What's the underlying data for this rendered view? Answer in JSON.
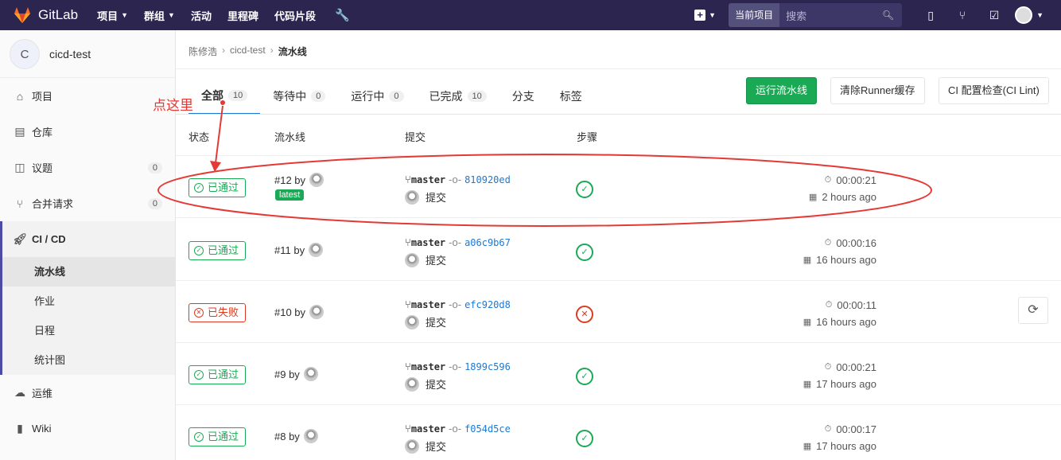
{
  "nav": {
    "brand": "GitLab",
    "links": [
      "项目",
      "群组",
      "活动",
      "里程碑",
      "代码片段"
    ],
    "search_scope": "当前项目",
    "search_placeholder": "搜索"
  },
  "sidebar": {
    "project_initial": "C",
    "project_name": "cicd-test",
    "items": [
      {
        "label": "项目",
        "icon": "home-icon"
      },
      {
        "label": "仓库",
        "icon": "doc-icon"
      },
      {
        "label": "议题",
        "icon": "issues-icon",
        "count": "0"
      },
      {
        "label": "合并请求",
        "icon": "merge-icon",
        "count": "0"
      },
      {
        "label": "CI / CD",
        "icon": "rocket-icon"
      }
    ],
    "sub_items": [
      "流水线",
      "作业",
      "日程",
      "统计图"
    ],
    "bottom_items": [
      {
        "label": "运维",
        "icon": "cloud-icon"
      },
      {
        "label": "Wiki",
        "icon": "book-icon"
      }
    ]
  },
  "breadcrumb": [
    "陈修浩",
    "cicd-test",
    "流水线"
  ],
  "tabs": [
    {
      "label": "全部",
      "count": "10"
    },
    {
      "label": "等待中",
      "count": "0"
    },
    {
      "label": "运行中",
      "count": "0"
    },
    {
      "label": "已完成",
      "count": "10"
    },
    {
      "label": "分支"
    },
    {
      "label": "标签"
    }
  ],
  "buttons": {
    "run": "运行流水线",
    "clear": "清除Runner缓存",
    "lint": "CI 配置检查(CI Lint)"
  },
  "columns": [
    "状态",
    "流水线",
    "提交",
    "步骤"
  ],
  "annotation": "点这里",
  "pipelines": [
    {
      "status": "已通过",
      "state": "passed",
      "id": "#12 by",
      "latest": "latest",
      "branch": "master",
      "sha": "810920ed",
      "msg": "提交",
      "duration": "00:00:21",
      "ago": "2 hours ago"
    },
    {
      "status": "已通过",
      "state": "passed",
      "id": "#11 by",
      "branch": "master",
      "sha": "a06c9b67",
      "msg": "提交",
      "duration": "00:00:16",
      "ago": "16 hours ago"
    },
    {
      "status": "已失败",
      "state": "failed",
      "id": "#10 by",
      "branch": "master",
      "sha": "efc920d8",
      "msg": "提交",
      "duration": "00:00:11",
      "ago": "16 hours ago"
    },
    {
      "status": "已通过",
      "state": "passed",
      "id": "#9 by",
      "branch": "master",
      "sha": "1899c596",
      "msg": "提交",
      "duration": "00:00:21",
      "ago": "17 hours ago"
    },
    {
      "status": "已通过",
      "state": "passed",
      "id": "#8 by",
      "branch": "master",
      "sha": "f054d5ce",
      "msg": "提交",
      "duration": "00:00:17",
      "ago": "17 hours ago"
    }
  ]
}
